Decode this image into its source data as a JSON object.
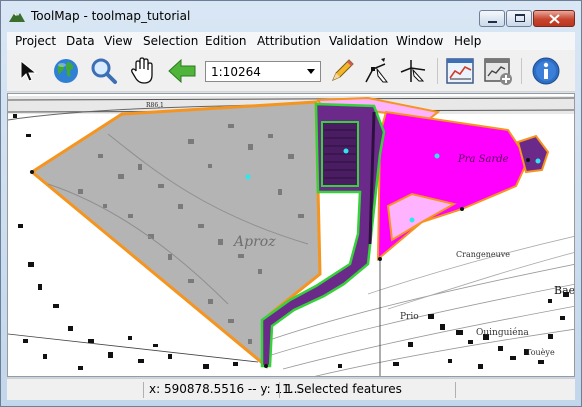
{
  "window": {
    "title": "ToolMap - toolmap_tutorial"
  },
  "menu": [
    "Project",
    "Data",
    "View",
    "Selection",
    "Edition",
    "Attribution",
    "Validation",
    "Window",
    "Help"
  ],
  "toolbar": {
    "scale_value": "1:10264"
  },
  "map": {
    "labels": {
      "apr": "Aproz",
      "pra_sarde": "Pra Sarde",
      "crangeneuve": "Crangeneuve",
      "bae": "Bae",
      "prio": "Prio",
      "ouinguiena": "Ouinguiéna",
      "toueye": "Touèye",
      "road": "R86,1"
    }
  },
  "status": {
    "coords": "x: 590878.5516 -- y: 11...",
    "selection": "1 Selected features"
  },
  "colors": {
    "titlebar": "#c2d6ec",
    "polygon_gray": "#b4b4b4",
    "polygon_magenta": "#ff00ff",
    "polygon_purple": "#6b2a8a",
    "boundary": "#f5941e",
    "selected_edge": "#36d23a"
  }
}
